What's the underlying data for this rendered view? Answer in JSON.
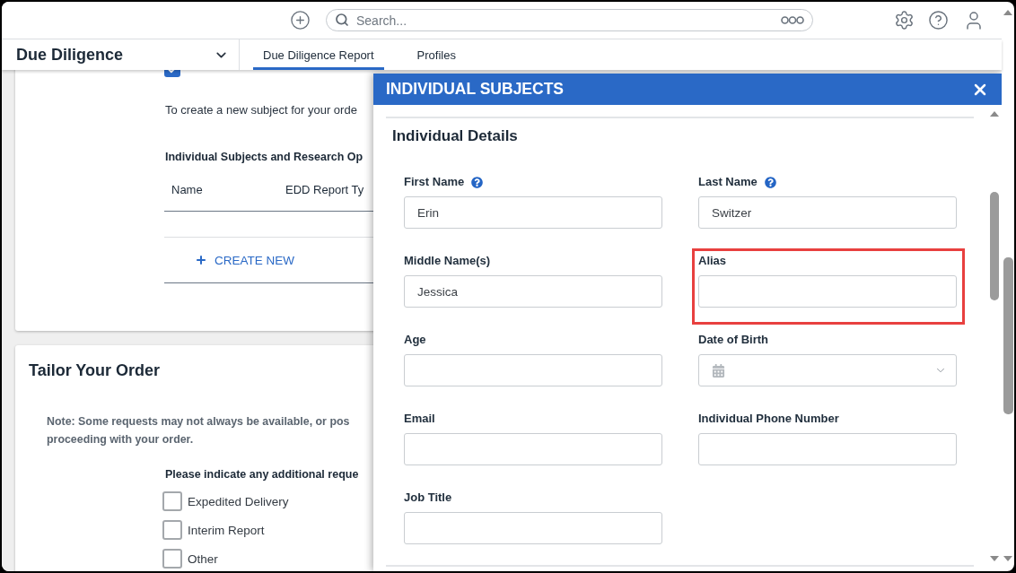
{
  "top_bar": {
    "search": {
      "placeholder": "Search..."
    }
  },
  "nav": {
    "module": "Due Diligence",
    "tabs": [
      {
        "label": "Due Diligence Report",
        "selected": true
      },
      {
        "label": "Profiles",
        "selected": false
      }
    ]
  },
  "subjects_card": {
    "type_checkbox": {
      "checked": true
    },
    "intro": "To create a new subject for your orde",
    "table_title": "Individual Subjects and Research Op",
    "columns": [
      "Name",
      "EDD Report Ty"
    ],
    "create_button": "CREATE NEW"
  },
  "tailor_card": {
    "title": "Tailor Your Order",
    "note_lines": [
      "Note: Some requests may not always be available, or pos",
      "proceeding with your order."
    ],
    "prompt": "Please indicate any additional reque",
    "options": [
      {
        "label": "Expedited Delivery",
        "checked": false
      },
      {
        "label": "Interim Report",
        "checked": false
      },
      {
        "label": "Other",
        "checked": false
      }
    ]
  },
  "modal": {
    "title": "INDIVIDUAL SUBJECTS",
    "section_title": "Individual Details",
    "fields": [
      {
        "label": "First Name",
        "kind": "text",
        "value": "Erin",
        "help": true,
        "highlighted": false
      },
      {
        "label": "Last Name",
        "kind": "text",
        "value": "Switzer",
        "help": true,
        "highlighted": false
      },
      {
        "label": "Middle Name(s)",
        "kind": "text",
        "value": "Jessica",
        "help": false,
        "highlighted": false
      },
      {
        "label": "Alias",
        "kind": "text",
        "help": false,
        "highlighted": true
      },
      {
        "label": "Age",
        "kind": "text",
        "help": false,
        "highlighted": false
      },
      {
        "label": "Date of Birth",
        "kind": "date",
        "help": false,
        "highlighted": false
      },
      {
        "label": "Email",
        "kind": "text",
        "help": false,
        "highlighted": false
      },
      {
        "label": "Individual Phone Number",
        "kind": "text",
        "help": false,
        "highlighted": false
      },
      {
        "label": "Job Title",
        "kind": "text",
        "help": false,
        "highlighted": false
      }
    ]
  }
}
